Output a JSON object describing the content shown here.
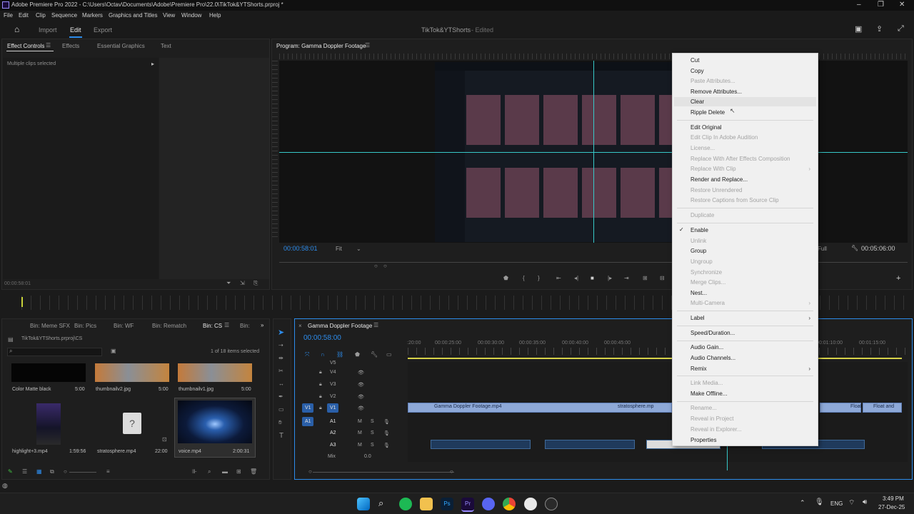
{
  "window": {
    "title": "Adobe Premiere Pro 2022 - C:\\Users\\Octav\\Documents\\Adobe\\Premiere Pro\\22.0\\TikTok&YTShorts.prproj *"
  },
  "menu": [
    "File",
    "Edit",
    "Clip",
    "Sequence",
    "Markers",
    "Graphics and Titles",
    "View",
    "Window",
    "Help"
  ],
  "workspace": {
    "import": "Import",
    "edit": "Edit",
    "export": "Export",
    "project": "TikTok&YTShorts",
    "status": "- Edited"
  },
  "effect_controls": {
    "tabs": [
      "Effect Controls",
      "Effects",
      "Essential Graphics",
      "Text"
    ],
    "message": "Multiple clips selected",
    "timecode": "00:00:58:01"
  },
  "program": {
    "title": "Program: Gamma Doppler Footage",
    "timecode": "00:00:58:01",
    "fit": "Fit",
    "quality": "Full",
    "duration": "00:05:06:00"
  },
  "project_panel": {
    "bins": [
      "Bin: Meme SFX",
      "Bin: Pics",
      "Bin: WF",
      "Bin: Rematch",
      "Bin: CS",
      "Bin:"
    ],
    "path": "TikTok&YTShorts.prproj\\CS",
    "selection": "1 of 18 items selected",
    "items": [
      {
        "name": "Color Matte black",
        "dur": "5:00"
      },
      {
        "name": "thumbnailv2.jpg",
        "dur": "5:00"
      },
      {
        "name": "thumbnailv1.jpg",
        "dur": "5:00"
      },
      {
        "name": "highlight+3.mp4",
        "dur": "1:59:56"
      },
      {
        "name": "stratosphere.mp4",
        "dur": "22:00"
      },
      {
        "name": "voice.mp4",
        "dur": "2:00:31"
      }
    ]
  },
  "timeline": {
    "title": "Gamma Doppler Footage",
    "timecode": "00:00:58:00",
    "ruler": [
      "00:00:25:00",
      "00:00:30:00",
      "00:00:35:00",
      "00:00:40:00",
      "00:00:45:00",
      "00:01:10:00",
      "00:01:15:00"
    ],
    "ruler_left": ":20:00",
    "video_tracks": [
      "V5",
      "V4",
      "V3",
      "V2",
      "V1"
    ],
    "audio_tracks": [
      "A1",
      "A2",
      "A3"
    ],
    "mix_label": "Mix",
    "mix_value": "0.0",
    "clip_v1": "Gamma Doppler Footage.mp4",
    "clip_v1b": "stratosphere.mp",
    "clip_v1c": "Float se",
    "clip_v1d": "Float and"
  },
  "context_menu": [
    {
      "label": "Cut",
      "enabled": true
    },
    {
      "label": "Copy",
      "enabled": true
    },
    {
      "label": "Paste Attributes...",
      "enabled": false
    },
    {
      "label": "Remove Attributes...",
      "enabled": true
    },
    {
      "label": "Clear",
      "enabled": true
    },
    {
      "label": "Ripple Delete",
      "enabled": true
    },
    {
      "label": "Edit Original",
      "enabled": true
    },
    {
      "label": "Edit Clip In Adobe Audition",
      "enabled": false
    },
    {
      "label": "License...",
      "enabled": false
    },
    {
      "label": "Replace With After Effects Composition",
      "enabled": false
    },
    {
      "label": "Replace With Clip",
      "enabled": false
    },
    {
      "label": "Render and Replace...",
      "enabled": true
    },
    {
      "label": "Restore Unrendered",
      "enabled": false
    },
    {
      "label": "Restore Captions from Source Clip",
      "enabled": false
    },
    {
      "label": "Duplicate",
      "enabled": false
    },
    {
      "label": "Enable",
      "enabled": true
    },
    {
      "label": "Unlink",
      "enabled": false
    },
    {
      "label": "Group",
      "enabled": true
    },
    {
      "label": "Ungroup",
      "enabled": false
    },
    {
      "label": "Synchronize",
      "enabled": false
    },
    {
      "label": "Merge Clips...",
      "enabled": false
    },
    {
      "label": "Nest...",
      "enabled": true
    },
    {
      "label": "Multi-Camera",
      "enabled": false
    },
    {
      "label": "Label",
      "enabled": true
    },
    {
      "label": "Speed/Duration...",
      "enabled": true
    },
    {
      "label": "Audio Gain...",
      "enabled": true
    },
    {
      "label": "Audio Channels...",
      "enabled": true
    },
    {
      "label": "Remix",
      "enabled": true
    },
    {
      "label": "Link Media...",
      "enabled": false
    },
    {
      "label": "Make Offline...",
      "enabled": true
    },
    {
      "label": "Rename...",
      "enabled": false
    },
    {
      "label": "Reveal in Project",
      "enabled": false
    },
    {
      "label": "Reveal in Explorer...",
      "enabled": false
    },
    {
      "label": "Properties",
      "enabled": true
    }
  ],
  "taskbar": {
    "lang": "ENG",
    "time": "3:49 PM",
    "date": "27-Dec-25",
    "ps_label": "Ps",
    "pr_label": "Pr"
  }
}
